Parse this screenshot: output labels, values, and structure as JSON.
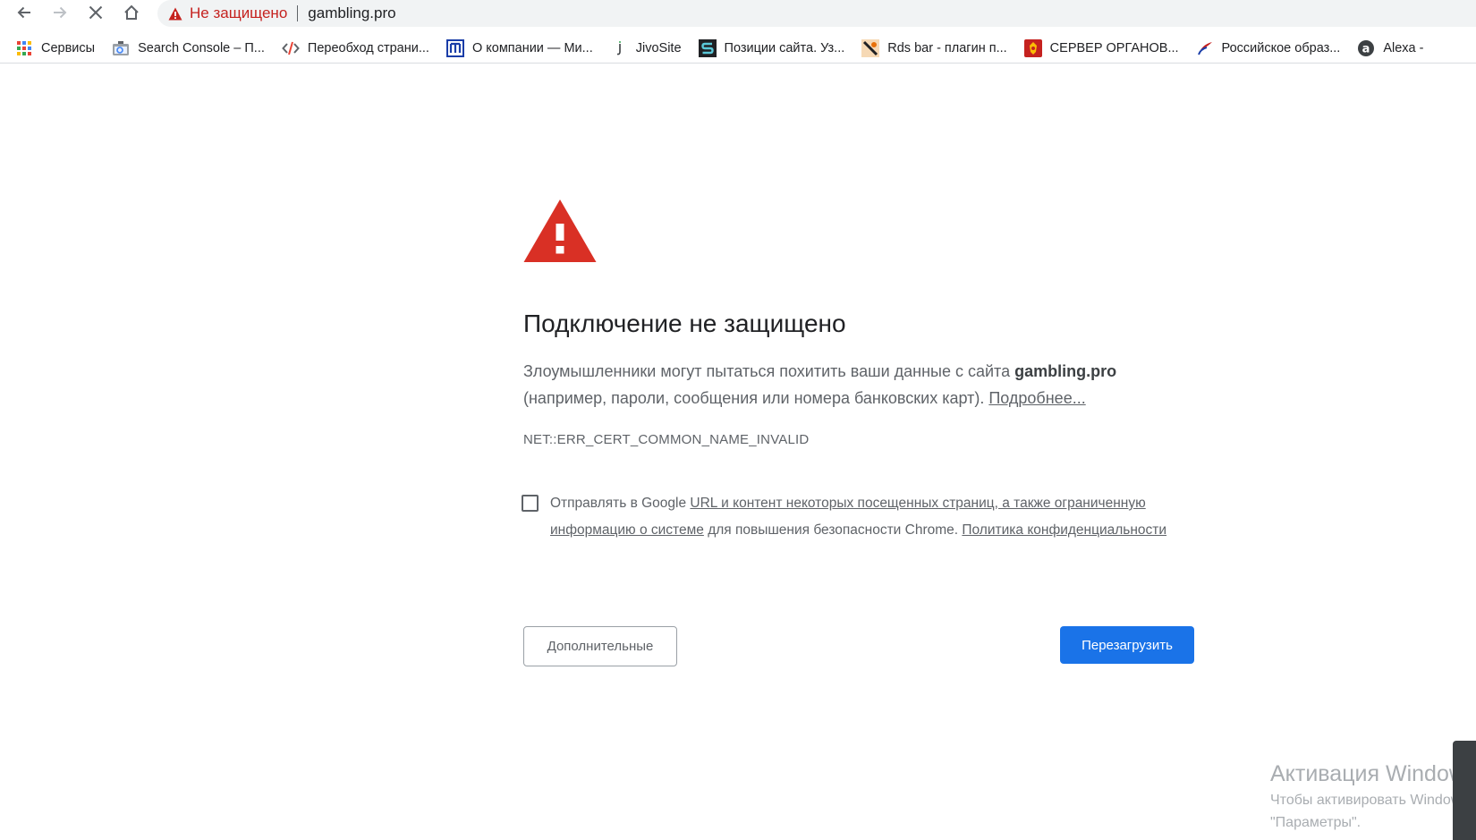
{
  "toolbar": {
    "security_label": "Не защищено",
    "url": "gambling.pro"
  },
  "bookmarks": [
    {
      "icon": "apps-grid-icon",
      "label": "Сервисы"
    },
    {
      "icon": "search-console-icon",
      "label": "Search Console – П..."
    },
    {
      "icon": "code-icon",
      "label": "Переобход страни..."
    },
    {
      "icon": "m-logo-icon",
      "label": "О компании — Ми..."
    },
    {
      "icon": "jivosite-icon",
      "label": "JivoSite"
    },
    {
      "icon": "s-logo-icon",
      "label": "Позиции сайта. Уз..."
    },
    {
      "icon": "rds-icon",
      "label": "Rds bar - плагин п..."
    },
    {
      "icon": "emblem-icon",
      "label": "СЕРВЕР ОРГАНОВ..."
    },
    {
      "icon": "flag-icon",
      "label": "Российское образ..."
    },
    {
      "icon": "alexa-icon",
      "label": "Alexa -"
    }
  ],
  "interstitial": {
    "heading": "Подключение не защищено",
    "explanation_prefix": "Злоумышленники могут пытаться похитить ваши данные с сайта",
    "domain": "gambling.pro",
    "explanation_suffix": "(например, пароли, сообщения или номера банковских карт).",
    "learn_more": "Подробнее...",
    "error_code": "NET::ERR_CERT_COMMON_NAME_INVALID",
    "optin_prefix": "Отправлять в Google",
    "optin_link": "URL и контент некоторых посещенных страниц, а также ограниченную информацию о системе",
    "optin_middle": "для повышения безопасности Chrome.",
    "optin_policy": "Политика конфиденциальности",
    "advanced_button": "Дополнительные",
    "reload_button": "Перезагрузить"
  },
  "watermark": {
    "title": "Активация Windows",
    "line1": "Чтобы активировать Windows,",
    "line2": "\"Параметры\"."
  },
  "colors": {
    "insecure": "#c5221f",
    "warning": "#d93025",
    "primary_button": "#1a73e8"
  }
}
